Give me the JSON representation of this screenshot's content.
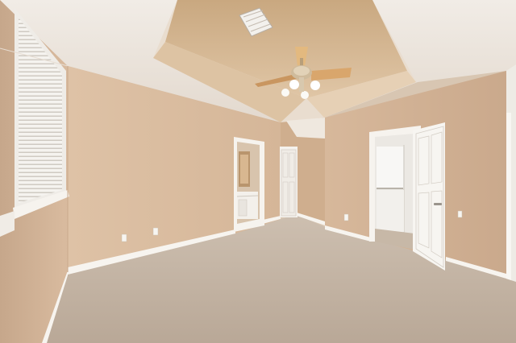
{
  "scene": {
    "description_colors": {
      "wall": "#dcbfa3",
      "wall_shadow": "#cbab8e",
      "ceiling": "#ece6df",
      "tray": "#d9bc99",
      "carpet": "#c8b9a8",
      "trim": "#f4f1ec"
    }
  }
}
